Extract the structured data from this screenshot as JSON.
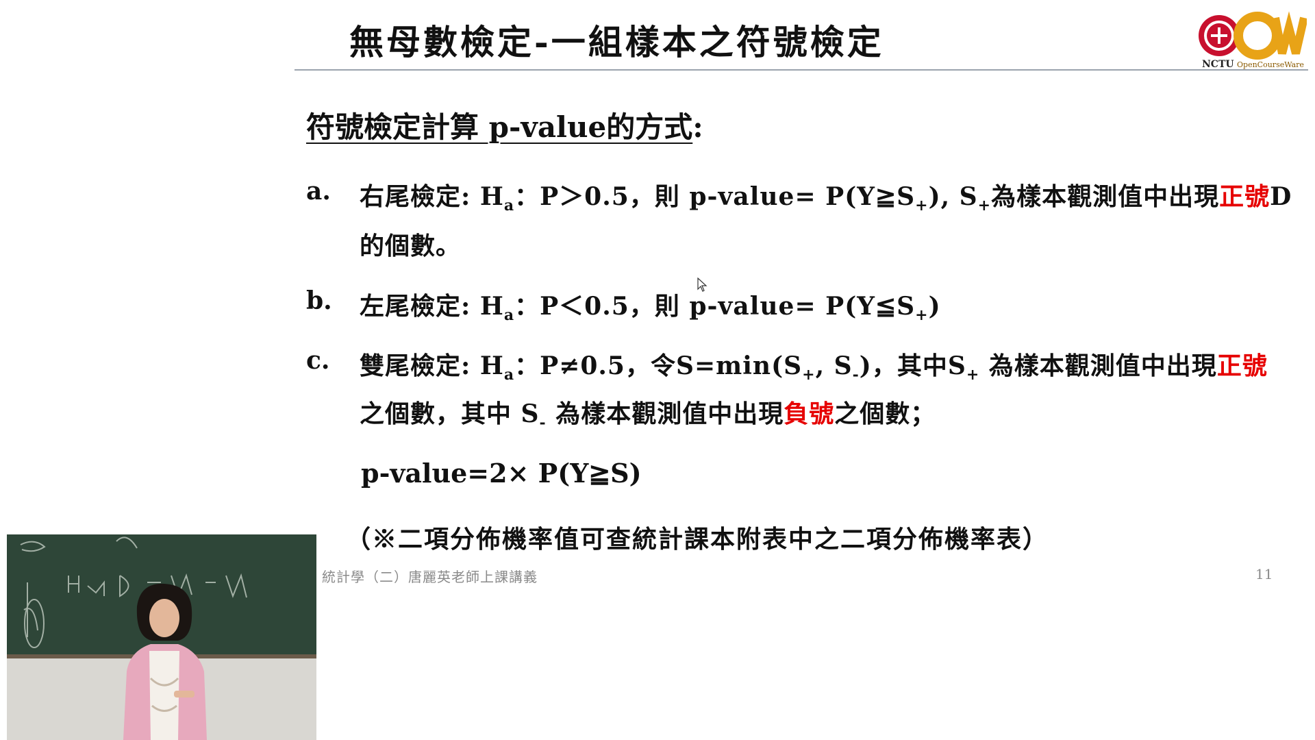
{
  "slide": {
    "title": "無母數檢定-一組樣本之符號檢定",
    "logo": {
      "brand": "NCTU",
      "tagline": "OpenCourseWare"
    },
    "heading": {
      "underlined": "符號檢定計算 p-value的方式",
      "colon": ":"
    },
    "items": [
      {
        "label": "a.",
        "lines": [
          [
            "右尾檢定: H",
            "a",
            "：P＞0.5，則 p-value= P(Y≧S",
            "+",
            "), S",
            "+",
            "為樣本觀測值中出現",
            "正號",
            "D"
          ],
          [
            "的個數。"
          ]
        ]
      },
      {
        "label": "b.",
        "lines": [
          [
            "左尾檢定: H",
            "a",
            "：P＜0.5，則 p-value= P(Y≦S",
            "+",
            ")"
          ]
        ]
      },
      {
        "label": "c.",
        "lines": [
          [
            "雙尾檢定: H",
            "a",
            "：P≠0.5，令S=min(S",
            "+",
            ", S",
            "-",
            ")，其中S",
            "+",
            " 為樣本觀測值中出現",
            "正號"
          ],
          [
            "之個數，其中 S",
            "-",
            " 為樣本觀測值中出現",
            "負號",
            "之個數；"
          ]
        ]
      }
    ],
    "formula": "p-value=2× P(Y≧S)",
    "note": "（※二項分佈機率值可查統計課本附表中之二項分佈機率表）",
    "footer": "統計學（二）唐麗英老師上課講義",
    "page_number": "11"
  },
  "colors": {
    "highlight": "#e60000",
    "rule": "#9aa3ad",
    "logo_red": "#c8102e",
    "logo_gold": "#e8a317"
  },
  "icons": [
    "ncku-seal-icon",
    "ocw-logo-icon",
    "mouse-cursor-icon"
  ]
}
